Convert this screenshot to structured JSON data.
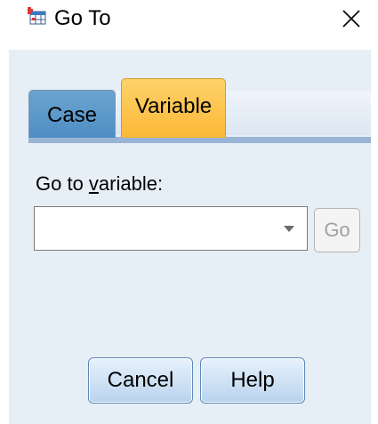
{
  "window": {
    "title": "Go To",
    "icon": "spss-data-grid-icon",
    "close_icon": "close-x-icon"
  },
  "tabs": [
    {
      "label": "Case",
      "selected": false
    },
    {
      "label": "Variable",
      "selected": true
    }
  ],
  "field": {
    "label_before": "Go to ",
    "label_mnemonic": "v",
    "label_after": "ariable:",
    "value": "",
    "dropdown_icon": "dropdown-arrow-icon"
  },
  "buttons": {
    "go": "Go",
    "cancel": "Cancel",
    "help": "Help"
  },
  "colors": {
    "tab_selected": "#fbb836",
    "tab_unselected": "#5a98c9",
    "dialog_background": "#e6eef6",
    "button_border": "#5c86b8"
  }
}
